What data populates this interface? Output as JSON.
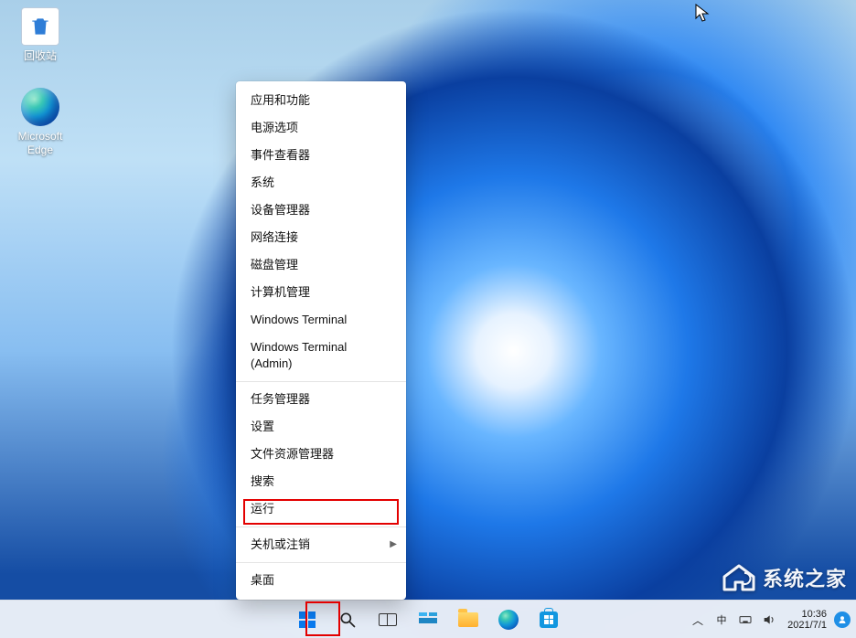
{
  "desktop_icons": {
    "recycle_bin": "回收站",
    "edge_line1": "Microsoft",
    "edge_line2": "Edge"
  },
  "power_menu": {
    "items": [
      {
        "label": "应用和功能"
      },
      {
        "label": "电源选项"
      },
      {
        "label": "事件查看器"
      },
      {
        "label": "系统"
      },
      {
        "label": "设备管理器"
      },
      {
        "label": "网络连接"
      },
      {
        "label": "磁盘管理"
      },
      {
        "label": "计算机管理"
      },
      {
        "label": "Windows Terminal"
      },
      {
        "label": "Windows Terminal (Admin)"
      }
    ],
    "items2": [
      {
        "label": "任务管理器"
      },
      {
        "label": "设置"
      },
      {
        "label": "文件资源管理器"
      },
      {
        "label": "搜索"
      },
      {
        "label": "运行"
      }
    ],
    "items3": [
      {
        "label": "关机或注销",
        "submenu": true
      }
    ],
    "items4": [
      {
        "label": "桌面"
      }
    ]
  },
  "system_tray": {
    "chevron": "︿",
    "ime": "中",
    "time": "10:36",
    "date": "2021/7/1"
  },
  "watermark": {
    "text": "系统之家"
  }
}
